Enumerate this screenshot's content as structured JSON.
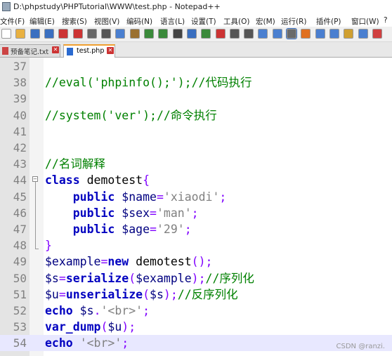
{
  "window": {
    "title": "D:\\phpstudy\\PHPTutorial\\WWW\\test.php - Notepad++"
  },
  "menu": [
    "文件(F)",
    "编辑(E)",
    "搜索(S)",
    "视图(V)",
    "编码(N)",
    "语言(L)",
    "设置(T)",
    "工具(O)",
    "宏(M)",
    "运行(R)",
    "插件(P)",
    "窗口(W)",
    "?"
  ],
  "tabs": [
    {
      "label": "预备笔记.txt",
      "active": false
    },
    {
      "label": "test.php",
      "active": true
    }
  ],
  "lines": [
    {
      "n": "37",
      "tokens": []
    },
    {
      "n": "38",
      "tokens": [
        {
          "t": "//eval('phpinfo();');//代码执行",
          "c": "cm"
        }
      ]
    },
    {
      "n": "39",
      "tokens": []
    },
    {
      "n": "40",
      "tokens": [
        {
          "t": "//system('ver');//命令执行",
          "c": "cm"
        }
      ]
    },
    {
      "n": "41",
      "tokens": []
    },
    {
      "n": "42",
      "tokens": []
    },
    {
      "n": "43",
      "tokens": [
        {
          "t": "//名词解释",
          "c": "cm"
        }
      ]
    },
    {
      "n": "44",
      "tokens": [
        {
          "t": "class",
          "c": "kw"
        },
        {
          "t": " demotest",
          "c": "pl"
        },
        {
          "t": "{",
          "c": "op"
        }
      ]
    },
    {
      "n": "45",
      "tokens": [
        {
          "t": "    ",
          "c": "pl"
        },
        {
          "t": "public",
          "c": "kw"
        },
        {
          "t": " $name",
          "c": "var"
        },
        {
          "t": "=",
          "c": "op"
        },
        {
          "t": "'xiaodi'",
          "c": "str"
        },
        {
          "t": ";",
          "c": "op"
        }
      ]
    },
    {
      "n": "46",
      "tokens": [
        {
          "t": "    ",
          "c": "pl"
        },
        {
          "t": "public",
          "c": "kw"
        },
        {
          "t": " $sex",
          "c": "var"
        },
        {
          "t": "=",
          "c": "op"
        },
        {
          "t": "'man'",
          "c": "str"
        },
        {
          "t": ";",
          "c": "op"
        }
      ]
    },
    {
      "n": "47",
      "tokens": [
        {
          "t": "    ",
          "c": "pl"
        },
        {
          "t": "public",
          "c": "kw"
        },
        {
          "t": " $age",
          "c": "var"
        },
        {
          "t": "=",
          "c": "op"
        },
        {
          "t": "'29'",
          "c": "str"
        },
        {
          "t": ";",
          "c": "op"
        }
      ]
    },
    {
      "n": "48",
      "tokens": [
        {
          "t": "}",
          "c": "op"
        }
      ]
    },
    {
      "n": "49",
      "tokens": [
        {
          "t": "$example",
          "c": "var"
        },
        {
          "t": "=",
          "c": "op"
        },
        {
          "t": "new",
          "c": "kw"
        },
        {
          "t": " demotest",
          "c": "pl"
        },
        {
          "t": "();",
          "c": "op"
        }
      ]
    },
    {
      "n": "50",
      "tokens": [
        {
          "t": "$s",
          "c": "var"
        },
        {
          "t": "=",
          "c": "op"
        },
        {
          "t": "serialize",
          "c": "kw"
        },
        {
          "t": "(",
          "c": "op"
        },
        {
          "t": "$example",
          "c": "var"
        },
        {
          "t": ");",
          "c": "op"
        },
        {
          "t": "//序列化",
          "c": "cm"
        }
      ]
    },
    {
      "n": "51",
      "tokens": [
        {
          "t": "$u",
          "c": "var"
        },
        {
          "t": "=",
          "c": "op"
        },
        {
          "t": "unserialize",
          "c": "kw"
        },
        {
          "t": "(",
          "c": "op"
        },
        {
          "t": "$s",
          "c": "var"
        },
        {
          "t": ");",
          "c": "op"
        },
        {
          "t": "//反序列化",
          "c": "cm"
        }
      ]
    },
    {
      "n": "52",
      "tokens": [
        {
          "t": "echo",
          "c": "kw"
        },
        {
          "t": " $s",
          "c": "var"
        },
        {
          "t": ".",
          "c": "op"
        },
        {
          "t": "'<br>'",
          "c": "str"
        },
        {
          "t": ";",
          "c": "op"
        }
      ]
    },
    {
      "n": "53",
      "tokens": [
        {
          "t": "var_dump",
          "c": "kw"
        },
        {
          "t": "(",
          "c": "op"
        },
        {
          "t": "$u",
          "c": "var"
        },
        {
          "t": ");",
          "c": "op"
        }
      ]
    },
    {
      "n": "54",
      "tokens": [
        {
          "t": "echo",
          "c": "kw"
        },
        {
          "t": " ",
          "c": "pl"
        },
        {
          "t": "'<br>'",
          "c": "str"
        },
        {
          "t": ";",
          "c": "op"
        }
      ],
      "current": true
    }
  ],
  "watermark": "CSDN @ranzi.",
  "toolbar_icons": [
    "new-icon",
    "open-icon",
    "save-icon",
    "save-all-icon",
    "close-icon",
    "close-all-icon",
    "print-icon",
    "cut-icon",
    "copy-icon",
    "paste-icon",
    "undo-icon",
    "redo-icon",
    "find-icon",
    "replace-icon",
    "zoom-in-icon",
    "zoom-out-icon",
    "sync-v-icon",
    "sync-h-icon",
    "wrap-icon",
    "all-chars-icon",
    "indent-guide-icon",
    "lang-icon",
    "doc-map-icon",
    "func-list-icon",
    "folder-icon",
    "monitor-icon",
    "record-icon"
  ],
  "colors": {
    "comment": "#008000",
    "keyword": "#0000c0",
    "string": "#808080",
    "operator": "#8000ff",
    "variable": "#000080",
    "current_line": "#e8e8ff"
  }
}
